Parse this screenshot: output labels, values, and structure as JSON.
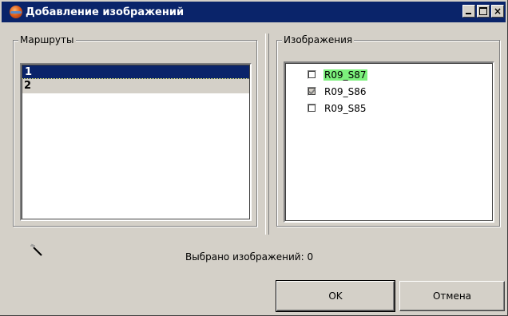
{
  "window": {
    "title": "Добавление изображений",
    "minimize_label": "_",
    "maximize_label": "",
    "close_label": "×"
  },
  "routes": {
    "label": "Маршруты",
    "items": [
      {
        "label": "1",
        "selected": true
      },
      {
        "label": "2",
        "selected": false
      }
    ]
  },
  "images": {
    "label": "Изображения",
    "items": [
      {
        "label": "R09_S87",
        "checked": false,
        "highlighted": true
      },
      {
        "label": "R09_S86",
        "checked": true,
        "highlighted": false
      },
      {
        "label": "R09_S85",
        "checked": false,
        "highlighted": false
      }
    ]
  },
  "status": {
    "text": "Выбрано изображений: 0",
    "icon": "magic-wand-icon"
  },
  "buttons": {
    "ok_label": "OK",
    "cancel_label": "Отмена"
  },
  "colors": {
    "titlebar": "#0a246a",
    "selection": "#0a246a",
    "highlight": "#7cf07c",
    "face": "#d4d0c8"
  }
}
